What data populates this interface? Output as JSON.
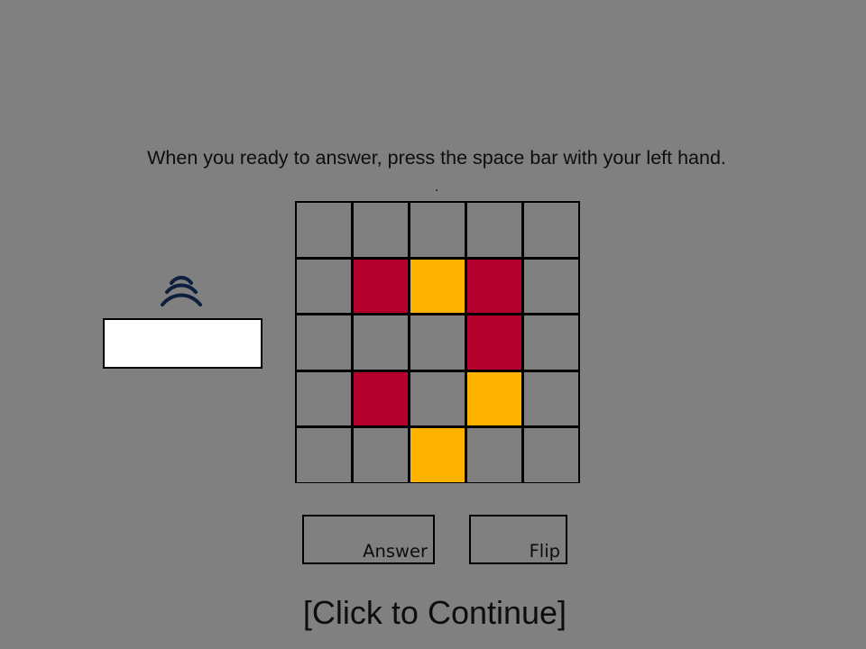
{
  "instruction_text": "When you ready to answer, press the space bar with your left hand.",
  "dot_text": ".",
  "answer_field": {
    "value": ""
  },
  "buttons": {
    "answer_label": "Answer",
    "flip_label": "Flip"
  },
  "continue_text": "[Click to Continue]",
  "icons": {
    "speaker": "sound-waves-icon"
  },
  "colors": {
    "background": "#808080",
    "red": "#b4002d",
    "yellow": "#ffb300",
    "grid_line": "#000000"
  },
  "grid": {
    "rows": 5,
    "columns": 5,
    "cells": [
      [
        "empty",
        "empty",
        "empty",
        "empty",
        "empty"
      ],
      [
        "empty",
        "red",
        "yellow",
        "red",
        "empty"
      ],
      [
        "empty",
        "empty",
        "empty",
        "red",
        "empty"
      ],
      [
        "empty",
        "red",
        "empty",
        "yellow",
        "empty"
      ],
      [
        "empty",
        "empty",
        "yellow",
        "empty",
        "empty"
      ]
    ]
  }
}
